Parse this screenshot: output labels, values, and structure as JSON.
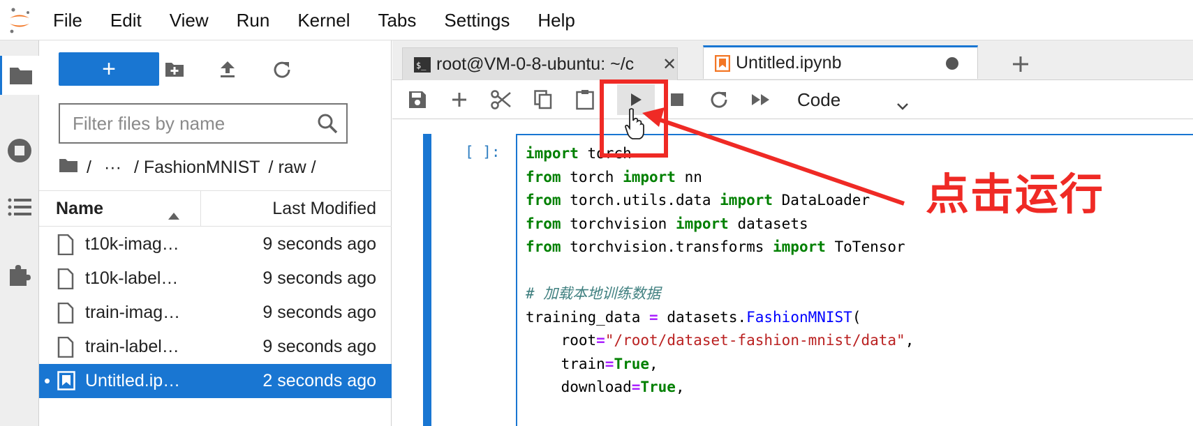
{
  "menubar": {
    "items": [
      "File",
      "Edit",
      "View",
      "Run",
      "Kernel",
      "Tabs",
      "Settings",
      "Help"
    ]
  },
  "activity_bar": {
    "icons": [
      "folder-icon",
      "stop-circle-icon",
      "list-icon",
      "puzzle-icon"
    ]
  },
  "file_browser": {
    "new_label": "+",
    "filter_placeholder": "Filter files by name",
    "breadcrumb": {
      "root": "/",
      "ellipsis": "···",
      "parts": [
        "/ FashionMNIST",
        "/ raw /"
      ]
    },
    "columns": {
      "name": "Name",
      "modified": "Last Modified"
    },
    "files": [
      {
        "name": "t10k-imag…",
        "modified": "9 seconds ago",
        "icon": "file-icon"
      },
      {
        "name": "t10k-label…",
        "modified": "9 seconds ago",
        "icon": "file-icon"
      },
      {
        "name": "train-imag…",
        "modified": "9 seconds ago",
        "icon": "file-icon"
      },
      {
        "name": "train-label…",
        "modified": "9 seconds ago",
        "icon": "file-icon"
      },
      {
        "name": "Untitled.ip…",
        "modified": "2 seconds ago",
        "icon": "notebook-icon",
        "selected": true,
        "running_dot": "•"
      }
    ]
  },
  "tabs": [
    {
      "title": "root@VM-0-8-ubuntu: ~/c",
      "icon": "terminal-icon",
      "close": "✕"
    },
    {
      "title": "Untitled.ipynb",
      "icon": "notebook-icon",
      "active": true
    }
  ],
  "notebook_toolbar": {
    "cell_type": "Code"
  },
  "cell": {
    "prompt": "[ ]:",
    "code_comment": "# 加载本地训练数据",
    "string_path": "\"/root/dataset-fashion-mnist/data\""
  },
  "annotation": {
    "label": "点击运行",
    "color": "#ef2a25"
  },
  "colors": {
    "accent": "#1976d2",
    "keyword": "#008000",
    "string": "#ba2121"
  }
}
